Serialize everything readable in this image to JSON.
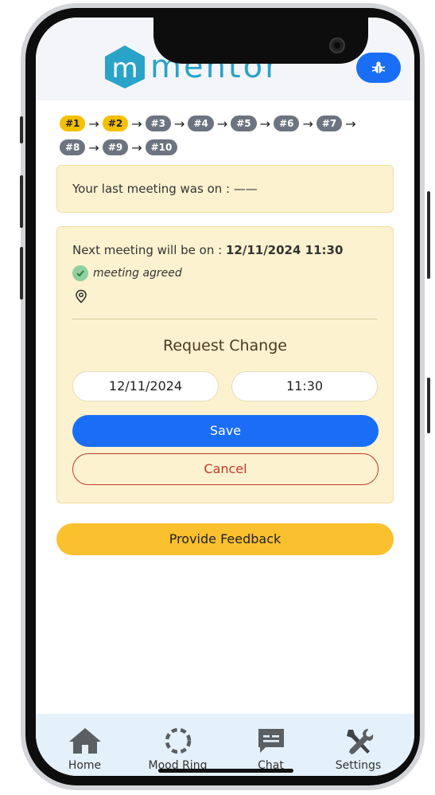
{
  "header": {
    "logo_text": "mentor",
    "logo_plus": "+",
    "bug_icon": "bug-icon",
    "colors": {
      "brand": "#2aa3c8",
      "accent": "#1a6ef5"
    }
  },
  "steps": {
    "row1": [
      "#1",
      "#2",
      "#3",
      "#4",
      "#5",
      "#6",
      "#7"
    ],
    "row2": [
      "#8",
      "#9",
      "#10"
    ],
    "active": [
      "#1",
      "#2"
    ]
  },
  "last_meeting": {
    "text": "Your last meeting was on : ——"
  },
  "next_meeting": {
    "prefix": "Next meeting will be on : ",
    "datetime": "12/11/2024 11:30",
    "status": "meeting agreed",
    "location_icon": "map-pin-icon"
  },
  "request_change": {
    "title": "Request Change",
    "date_value": "12/11/2024",
    "time_value": "11:30",
    "save_label": "Save",
    "cancel_label": "Cancel"
  },
  "feedback": {
    "label": "Provide Feedback"
  },
  "tabbar": {
    "items": [
      {
        "label": "Home",
        "icon": "home-icon"
      },
      {
        "label": "Mood Ring",
        "icon": "mood-ring-icon"
      },
      {
        "label": "Chat",
        "icon": "chat-icon"
      },
      {
        "label": "Settings",
        "icon": "settings-icon"
      }
    ]
  }
}
